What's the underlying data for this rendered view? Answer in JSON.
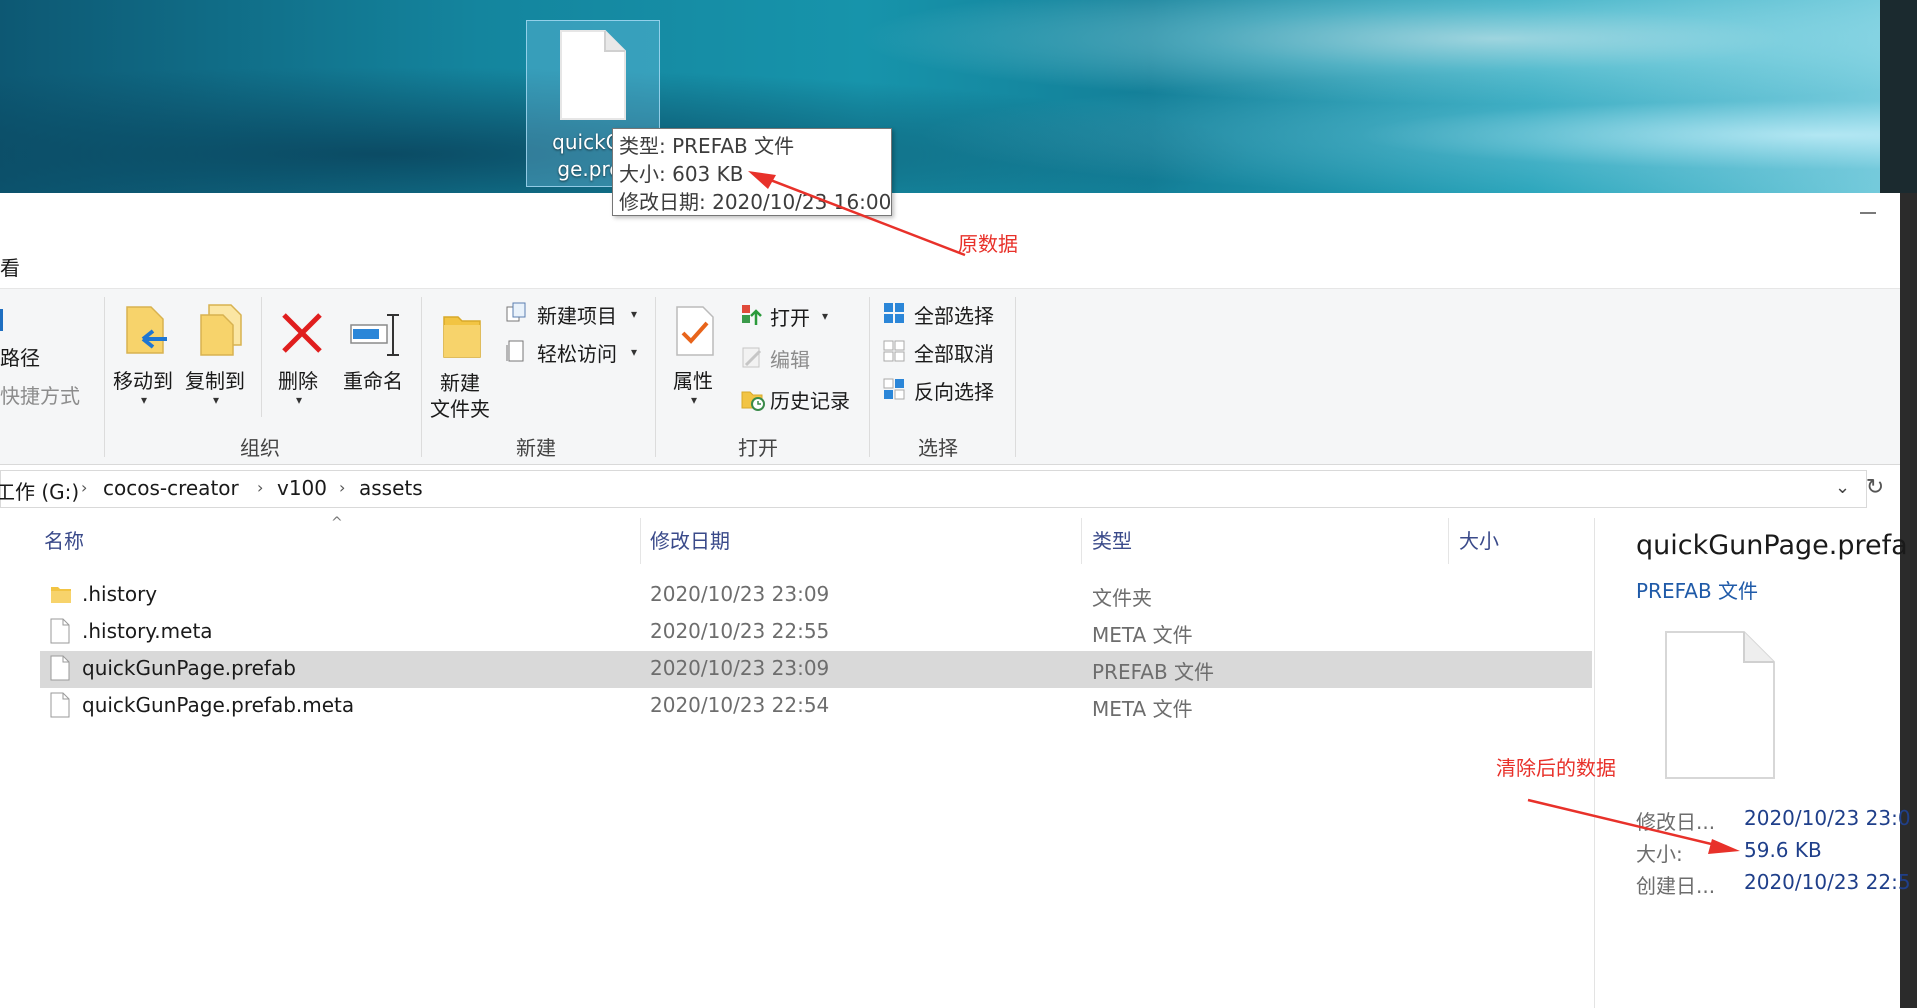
{
  "desktop": {
    "icon_label_line1": "quickGu",
    "icon_label_line2": "ge.pref"
  },
  "tooltip": {
    "type_line": "类型: PREFAB 文件",
    "size_line": "大小: 603 KB",
    "date_line": "修改日期: 2020/10/23 16:00"
  },
  "annotations": {
    "original": "原数据",
    "cleaned": "清除后的数据"
  },
  "tabs": {
    "view": "看"
  },
  "ribbon": {
    "clipboard_partial": {
      "path_label": "路径",
      "shortcut_label": "快捷方式"
    },
    "organize": {
      "move_to": "移动到",
      "copy_to": "复制到",
      "delete": "删除",
      "rename": "重命名",
      "group_label": "组织"
    },
    "new": {
      "new_folder_line1": "新建",
      "new_folder_line2": "文件夹",
      "new_item": "新建项目",
      "easy_access": "轻松访问",
      "group_label": "新建"
    },
    "open": {
      "properties": "属性",
      "open": "打开",
      "edit": "编辑",
      "history": "历史记录",
      "group_label": "打开"
    },
    "select": {
      "select_all": "全部选择",
      "select_none": "全部取消",
      "invert": "反向选择",
      "group_label": "选择"
    }
  },
  "address": {
    "crumbs": [
      "工作 (G:)",
      "cocos-creator",
      "v100",
      "assets"
    ],
    "refresh_icon": "refresh-icon"
  },
  "columns": {
    "name": "名称",
    "modified": "修改日期",
    "type": "类型",
    "size": "大小"
  },
  "files": [
    {
      "name": ".history",
      "modified": "2020/10/23 23:09",
      "type": "文件夹",
      "kind": "folder"
    },
    {
      "name": ".history.meta",
      "modified": "2020/10/23 22:55",
      "type": "META 文件",
      "kind": "file"
    },
    {
      "name": "quickGunPage.prefab",
      "modified": "2020/10/23 23:09",
      "type": "PREFAB 文件",
      "kind": "file",
      "selected": true
    },
    {
      "name": "quickGunPage.prefab.meta",
      "modified": "2020/10/23 22:54",
      "type": "META 文件",
      "kind": "file"
    }
  ],
  "details": {
    "title": "quickGunPage.prefa",
    "type": "PREFAB 文件",
    "props": [
      {
        "key": "修改日...",
        "value": "2020/10/23 23:0"
      },
      {
        "key": "大小:",
        "value": "59.6 KB"
      },
      {
        "key": "创建日...",
        "value": "2020/10/23 22:5"
      }
    ]
  },
  "colors": {
    "accent": "#1f5aa8",
    "annotation": "#e8312a",
    "selected_row": "#d9d9d9"
  }
}
